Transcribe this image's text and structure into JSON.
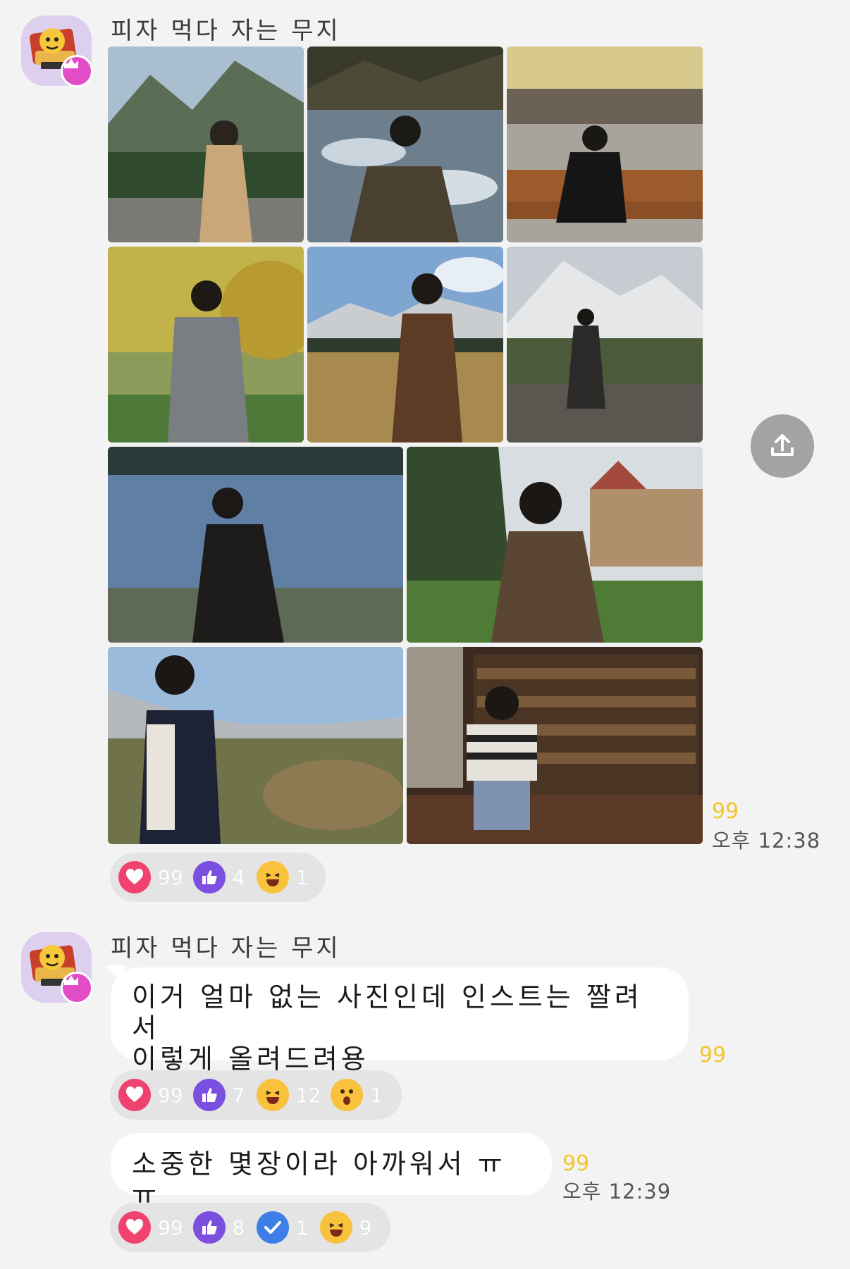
{
  "messages": [
    {
      "sender": "피자 먹다 자는 무지",
      "unread": "99",
      "time": "오후 12:38",
      "reactions": [
        {
          "icon": "heart-icon",
          "count": "99"
        },
        {
          "icon": "thumbs-up-icon",
          "count": "4"
        },
        {
          "icon": "laughing-face-icon",
          "count": "1"
        }
      ]
    },
    {
      "sender": "피자 먹다 자는 무지",
      "text_line1": "이거 얼마 없는 사진인데 인스트는 짤려서",
      "text_line2": "이렇게 올려드려용",
      "unread": "99",
      "reactions": [
        {
          "icon": "heart-icon",
          "count": "99"
        },
        {
          "icon": "thumbs-up-icon",
          "count": "7"
        },
        {
          "icon": "laughing-face-icon",
          "count": "12"
        },
        {
          "icon": "surprised-face-icon",
          "count": "1"
        }
      ]
    },
    {
      "text": "소중한 몇장이라 아까워서 ㅠㅠ",
      "unread": "99",
      "time": "오후 12:39",
      "reactions": [
        {
          "icon": "heart-icon",
          "count": "99"
        },
        {
          "icon": "thumbs-up-icon",
          "count": "8"
        },
        {
          "icon": "check-icon",
          "count": "1"
        },
        {
          "icon": "laughing-face-icon",
          "count": "9"
        }
      ]
    }
  ],
  "colors": {
    "background": "#f3f3f3",
    "unread": "#f2c72c",
    "heart": "#f0426e",
    "thumbs": "#7b4fe0",
    "check": "#3d7fe6",
    "emoji": "#f9c23c",
    "crown_badge": "#e24cc7"
  }
}
